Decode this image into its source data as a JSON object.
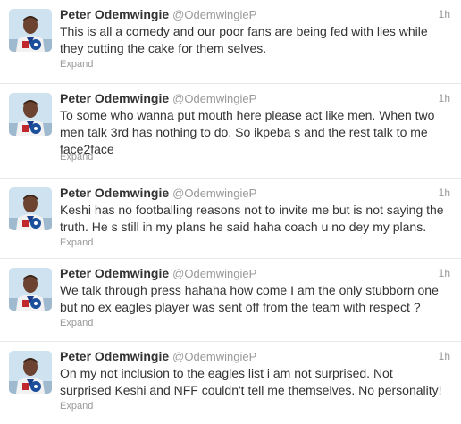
{
  "tweets": [
    {
      "name": "Peter Odemwingie",
      "handle": "@OdemwingieP",
      "time": "1h",
      "lines": [
        "This is all a comedy and our poor fans are being fed with lies while",
        "they cutting the cake for them selves."
      ],
      "expand": "Expand"
    },
    {
      "name": "Peter Odemwingie",
      "handle": "@OdemwingieP",
      "time": "1h",
      "lines": [
        "To some who wanna put mouth here please act like men. When two",
        "men talk 3rd has nothing to do. So ikpeba s and the rest talk to me",
        "face2face"
      ],
      "expand": "Expand"
    },
    {
      "name": "Peter Odemwingie",
      "handle": "@OdemwingieP",
      "time": "1h",
      "lines": [
        "Keshi has no footballing reasons not to invite me but is not saying the",
        "truth. He s still in my plans he said haha coach u no dey my plans."
      ],
      "expand": "Expand"
    },
    {
      "name": "Peter Odemwingie",
      "handle": "@OdemwingieP",
      "time": "1h",
      "lines": [
        "We talk through press hahaha how come I am the only stubborn one",
        "but no ex eagles player was sent off from the team with respect ?"
      ],
      "expand": "Expand"
    },
    {
      "name": "Peter Odemwingie",
      "handle": "@OdemwingieP",
      "time": "1h",
      "lines": [
        "On my not inclusion to the eagles list i am not surprised. Not",
        "surprised Keshi and NFF couldn't tell me themselves. No personality!"
      ],
      "expand": "Expand"
    }
  ]
}
